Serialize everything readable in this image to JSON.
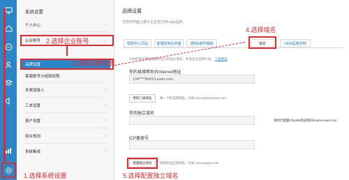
{
  "rail": {
    "icons": [
      "monitor-icon",
      "home-icon",
      "document-icon",
      "chat-icon",
      "user-icon",
      "layers-icon",
      "megaphone-icon",
      "chart-icon",
      "settings-icon"
    ]
  },
  "sidebar": {
    "heading": "系统设置",
    "items": [
      {
        "label": "个人中心"
      },
      {
        "label": "企业账号"
      },
      {
        "label": "品牌设置"
      },
      {
        "label": "客服账号分组和权限"
      },
      {
        "label": "多渠道接入"
      },
      {
        "label": "工单设置"
      },
      {
        "label": "客户设置"
      },
      {
        "label": "商业规则"
      },
      {
        "label": "系统集成"
      }
    ]
  },
  "main": {
    "title": "品牌设置",
    "subtitle": "在软件界面上展示企业自己的Logo品牌。",
    "tabs": [
      "帮助中心页站",
      "客服控制台界面",
      "通知&邮件模板",
      "域名",
      "OEM品牌定制"
    ],
    "description": "为你的服务网站配置你自己的独立域名，彰显自主品牌价值。",
    "description_link": "了解更多",
    "help_center_label": "你的易维帮助台Internet地址",
    "help_center_url": "134****89013.ewei.com",
    "change_button": "更改二级域名",
    "change_hint": "换一个好记的域名，比如 mycompany.ewei.com",
    "custom_domain_label": "你的独立域名",
    "cname_hint": "请另行配置CNAME别名指向cname.ewei.com",
    "icp_label": "ICP备案号",
    "config_button": "配置独立域名",
    "config_hint": "操作你自己的域名，比如 mycompany.com"
  },
  "annotations": {
    "step1": "1.选择系统设置",
    "step2": "2.选择企业账号",
    "step3": "3.选择品牌设置",
    "step4": "4.选择域名",
    "step5": "5.选择配置独立域名"
  },
  "colors": {
    "accent": "#2b86c8",
    "annotation": "#e8262b"
  }
}
